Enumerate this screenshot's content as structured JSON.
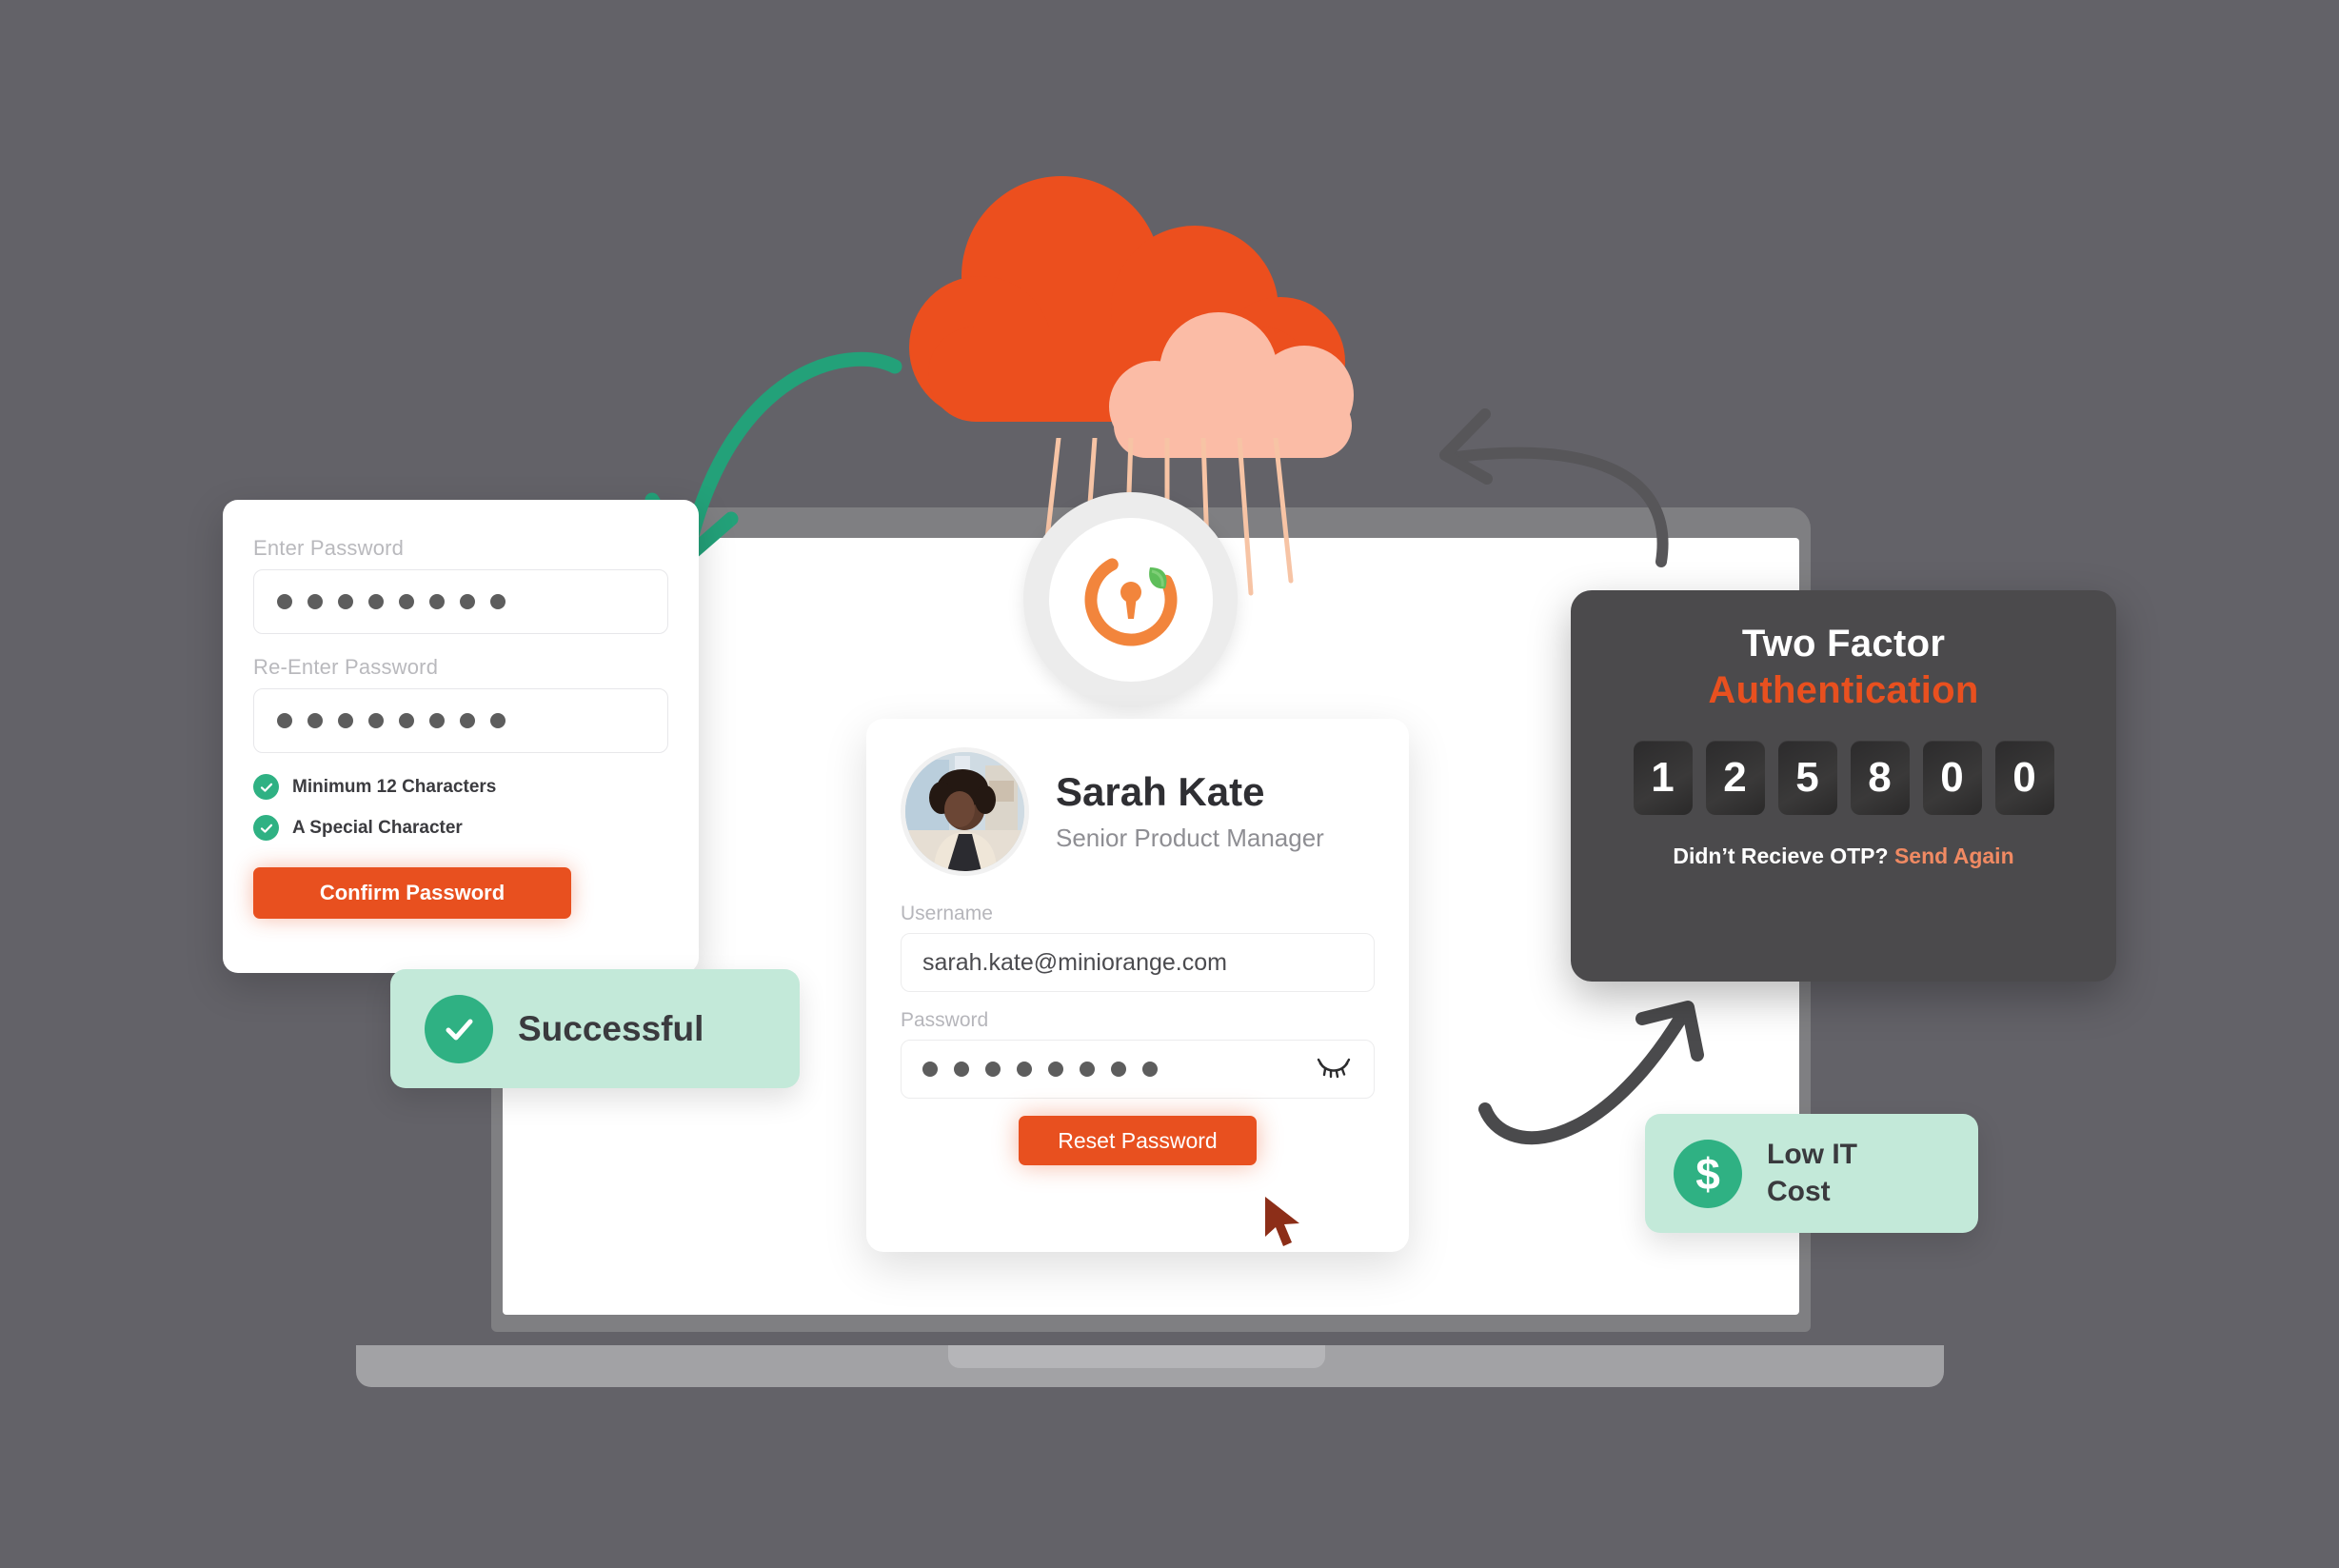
{
  "theme": {
    "background": "#636268",
    "orange": "#E8501F",
    "orange_cloud": "#EC4F1E",
    "orange_cloud_light": "#FBBCA6",
    "green": "#2FB183",
    "green_pill": "#C3E9D9",
    "arrow_green": "#23A179",
    "arrow_gray": "#575659",
    "arrow_dark": "#4a4a4c",
    "panel_dark": "#4b4a4c",
    "laptop_bezel": "#7f7f82",
    "laptop_base": "#a2a2a5",
    "cursor": "#8C2E18",
    "send_again": "#F08A63"
  },
  "logo": {
    "name": "miniorange-logo-icon",
    "ring_color": "#F2853C",
    "leaf_color": "#5EBE5A"
  },
  "cloud": {
    "name": "cloud-icon",
    "rain_lines": 7
  },
  "password_card": {
    "enter_password_label": "Enter Password",
    "reenter_password_label": "Re-Enter Password",
    "enter_password_dots": 8,
    "reenter_password_dots": 8,
    "rules": [
      {
        "icon": "check-circle-icon",
        "label": "Minimum 12 Characters",
        "met": true
      },
      {
        "icon": "check-circle-icon",
        "label": "A Special Character",
        "met": true
      }
    ],
    "confirm_button_label": "Confirm Password"
  },
  "profile_card": {
    "avatar_name": "avatar",
    "name": "Sarah Kate",
    "role": "Senior Product Manager",
    "username_label": "Username",
    "username_value": "sarah.kate@miniorange.com",
    "password_label": "Password",
    "password_dots": 8,
    "toggle_icon": "eye-off-icon",
    "reset_button_label": "Reset Password",
    "cursor_icon": "mouse-cursor-icon"
  },
  "twofa": {
    "title_line1": "Two Factor",
    "title_line2": "Authentication",
    "otp_digits": [
      "1",
      "2",
      "5",
      "8",
      "0",
      "0"
    ],
    "footer_prompt": "Didn’t Recieve OTP?",
    "resend_label": "Send Again"
  },
  "badges": {
    "successful": {
      "icon": "check-icon",
      "label": "Successful"
    },
    "low_it_cost": {
      "icon": "dollar-icon",
      "label_line1": "Low IT",
      "label_line2": "Cost"
    }
  },
  "arrows": [
    {
      "name": "arrow-cloud-to-password-card",
      "color": "#23A179"
    },
    {
      "name": "arrow-twofa-to-cloud",
      "color": "#575659"
    },
    {
      "name": "arrow-laptop-to-twofa",
      "color": "#4a4a4c"
    }
  ]
}
